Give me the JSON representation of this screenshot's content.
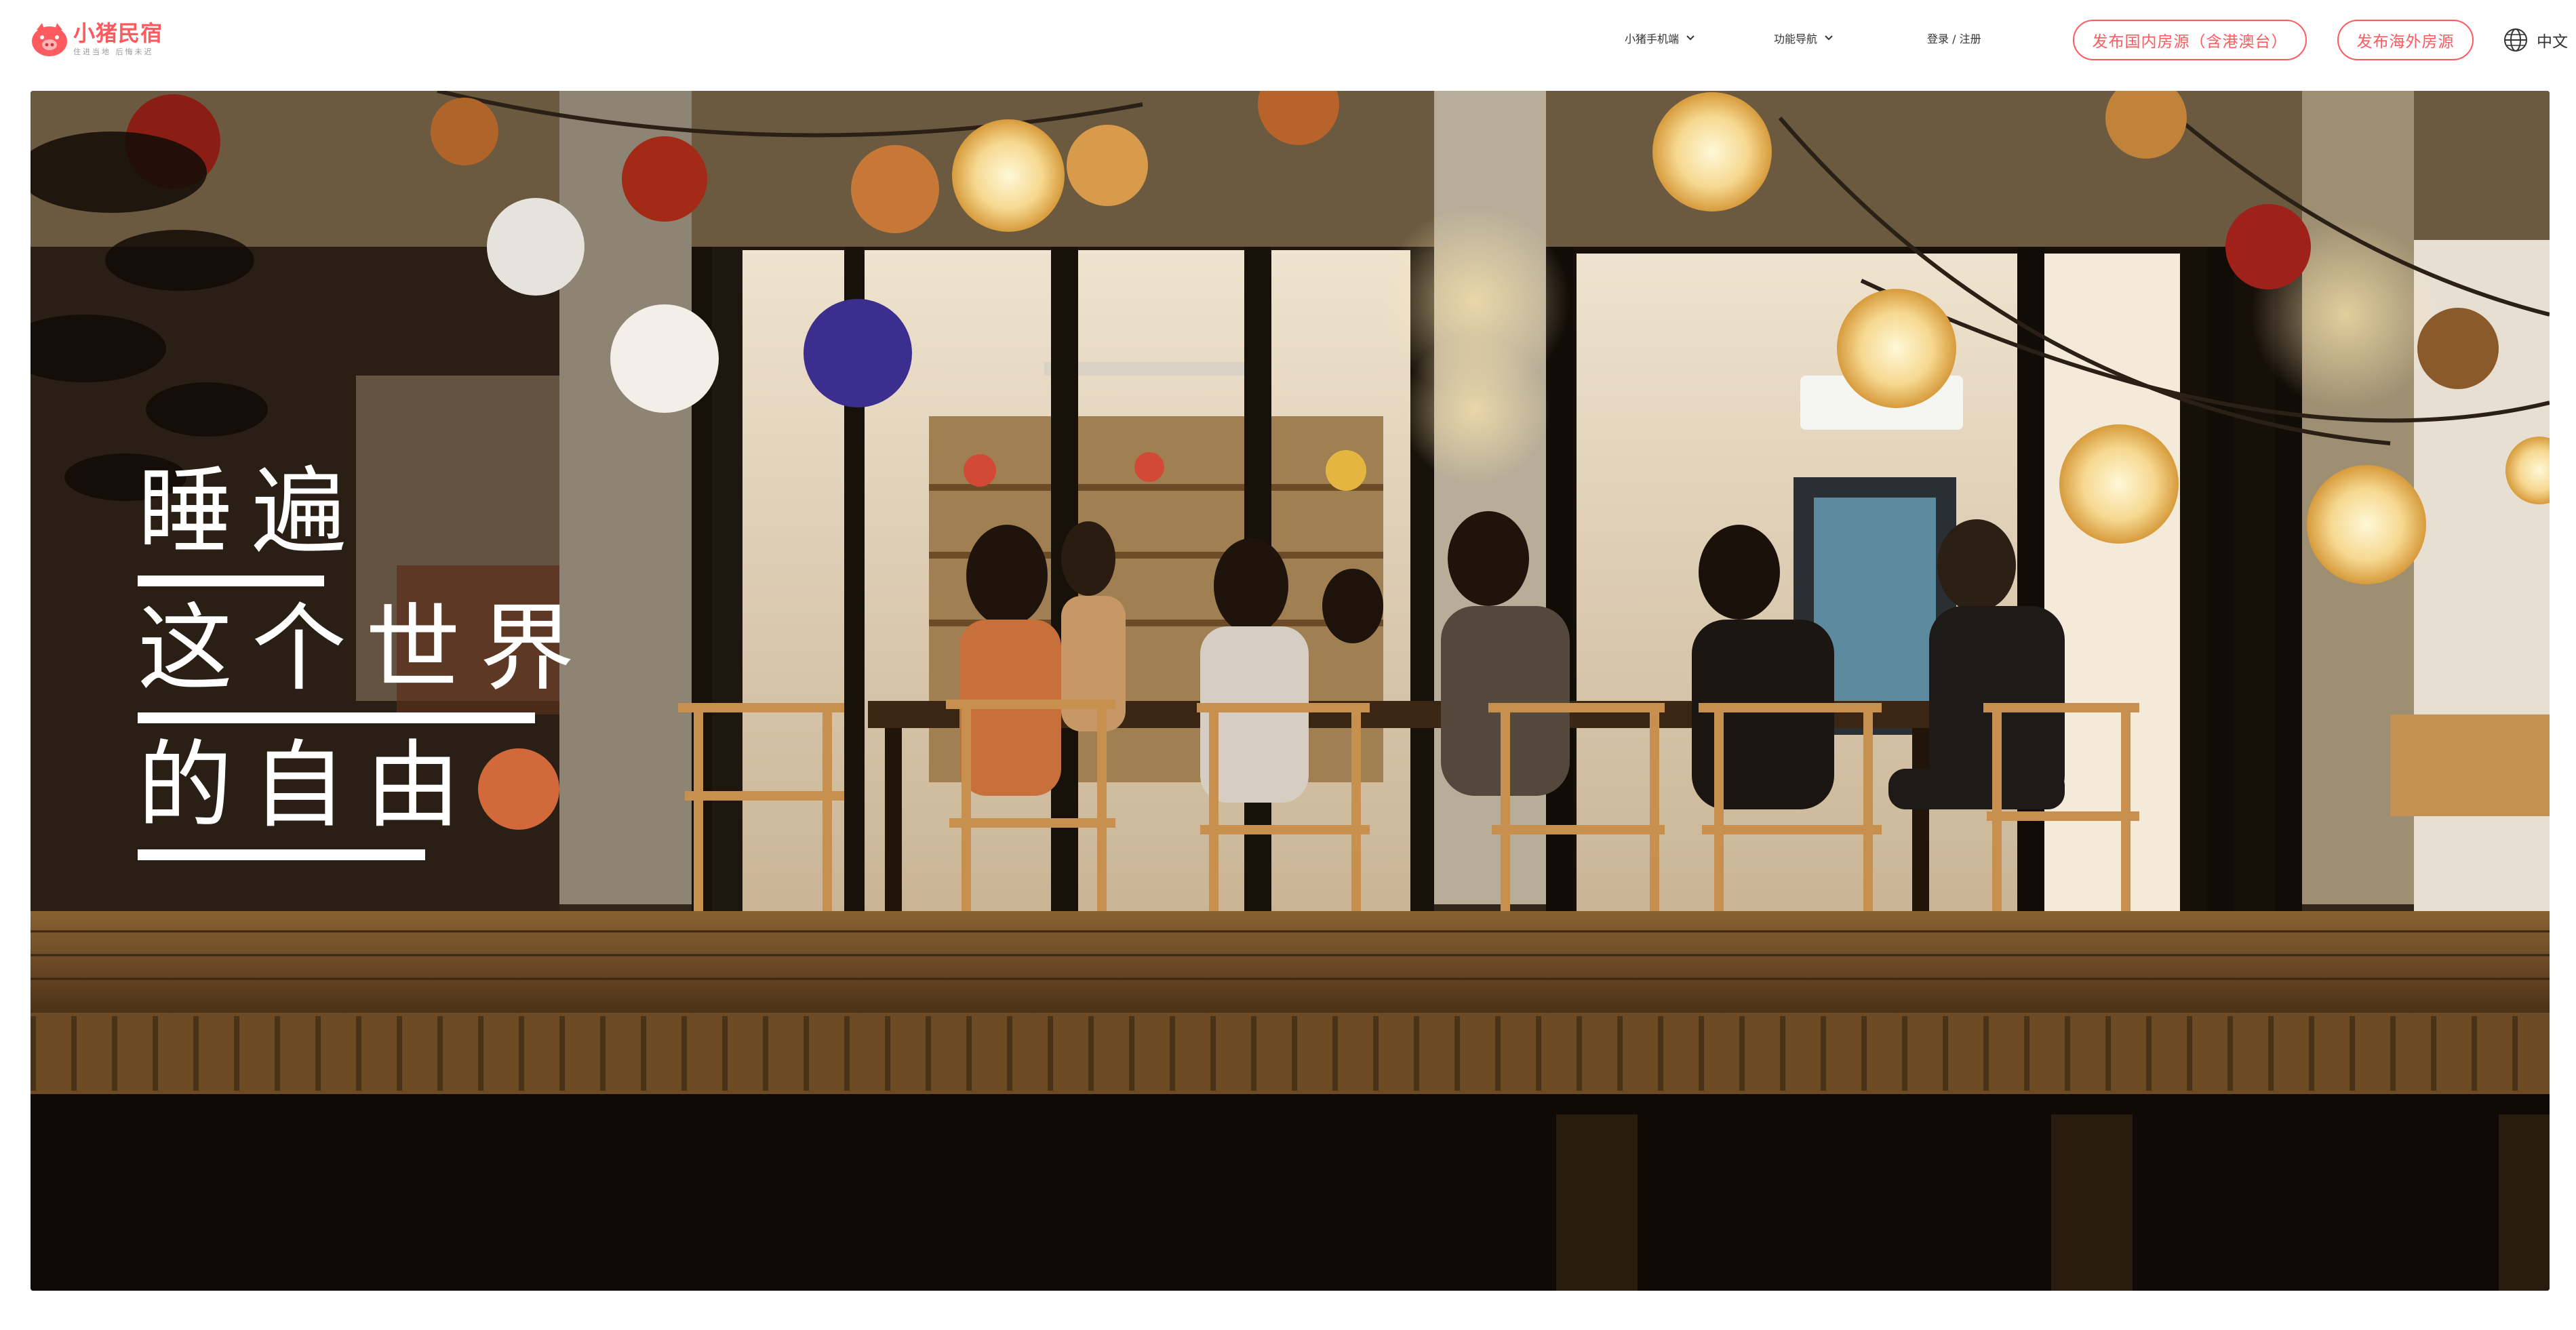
{
  "header": {
    "logo_name": "小猪民宿",
    "logo_slogan": "住进当地 后悔未迟",
    "nav": {
      "mobile": "小猪手机端",
      "features": "功能导航",
      "login": "登录 / 注册",
      "publish_domestic": "发布国内房源（含港澳台）",
      "publish_overseas": "发布海外房源",
      "language": "中文"
    }
  },
  "hero": {
    "lines": [
      "睡遍",
      "这个世界",
      "的自由"
    ]
  },
  "colors": {
    "brand": "#ff5a5f",
    "text": "#333333",
    "hero_text": "#ffffff"
  },
  "icons": [
    "pig-logo-icon",
    "chevron-down-icon",
    "globe-icon"
  ]
}
